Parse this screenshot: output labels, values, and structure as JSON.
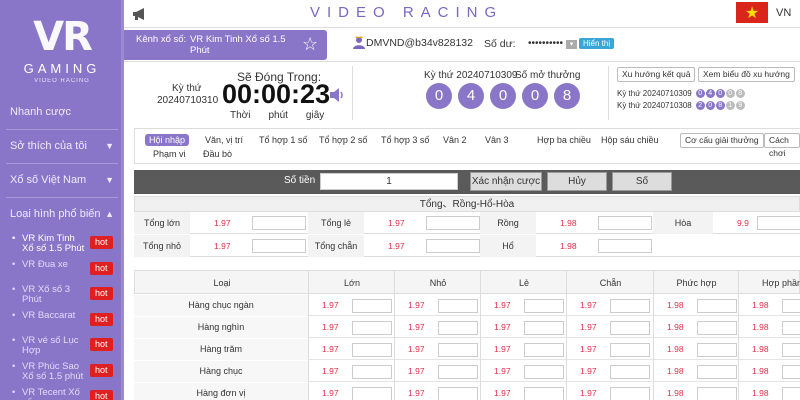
{
  "brand": {
    "logo_main": "VR",
    "logo_gaming": "GAMING",
    "logo_sub": "VIDEO RACING"
  },
  "sidebar": {
    "items": [
      {
        "label": "Nhanh cược",
        "caret": ""
      },
      {
        "label": "Sở thích của tôi",
        "caret": "▼"
      },
      {
        "label": "Xổ số Việt Nam",
        "caret": "▼"
      },
      {
        "label": "Loại hình phổ biến",
        "caret": "▲"
      }
    ],
    "games": [
      {
        "label": "VR Kim Tinh Xổ số 1.5 Phút",
        "badge": "hot"
      },
      {
        "label": "VR Đua xe",
        "badge": "hot"
      },
      {
        "label": "VR Xổ số 3 Phút",
        "badge": "hot"
      },
      {
        "label": "VR Baccarat",
        "badge": "hot"
      },
      {
        "label": "VR vé số Lục Hợp",
        "badge": "hot"
      },
      {
        "label": "VR Phúc Sao Xổ số 1.5 phút",
        "badge": "hot"
      },
      {
        "label": "VR Tecent Xổ số",
        "badge": "hot"
      }
    ]
  },
  "topbar": {
    "title": "VIDEO RACING",
    "lang": "VN",
    "flag_star": "★"
  },
  "channel": {
    "label": "Kênh xổ số:",
    "value": "VR Kim Tinh Xổ số 1.5 Phút",
    "user_id": "DMVND@b34v828132",
    "balance_label": "Số dư:",
    "balance_value": "••••••••••",
    "dropdown": "▾",
    "show_button": "Hiển thị"
  },
  "draw": {
    "kythu_label": "Kỳ thứ",
    "kythu_value": "20240710310",
    "countdown_title": "Sẽ Đóng Trong:",
    "countdown": "00:00:23",
    "units": {
      "hours": "Thời",
      "minutes": "phút",
      "seconds": "giây"
    },
    "last_draw_label": "Kỳ thứ 20240710309",
    "result_label": "Số mở thưởng",
    "result_balls": [
      "0",
      "4",
      "0",
      "0",
      "8"
    ],
    "trend_button": "Xu hướng kết quả",
    "chart_button": "Xem biểu đồ xu hướng",
    "history": [
      {
        "label": "Kỳ thứ 20240710309",
        "balls": [
          "0",
          "4",
          "0",
          "0",
          "8"
        ],
        "grey": [
          false,
          false,
          false,
          true,
          true
        ]
      },
      {
        "label": "Kỳ thứ 20240710308",
        "balls": [
          "2",
          "0",
          "8",
          "1",
          "9"
        ],
        "grey": [
          false,
          false,
          false,
          true,
          true
        ]
      }
    ]
  },
  "tabs": {
    "row1": [
      "Hội nhập",
      "Văn, vị trí",
      "Tổ hợp 1 số",
      "Tổ hợp 2 số",
      "Tổ hợp 3 số",
      "Vân 2",
      "Vân 3",
      "Hợp ba chiều",
      "Hộp sáu chiều"
    ],
    "row2": [
      "Phạm vi",
      "Đầu bò"
    ],
    "right_buttons": [
      "Cơ cấu giải thưởng",
      "Cách chơi"
    ]
  },
  "amount": {
    "label": "Số tiền",
    "value": "1",
    "confirm": "Xác nhận cược",
    "cancel": "Hủy",
    "number": "Số"
  },
  "section1": {
    "title": "Tổng、Rồng-Hổ-Hòa",
    "rows": [
      [
        {
          "name": "Tổng lớn",
          "odds": "1.97"
        },
        {
          "name": "Tổng lẻ",
          "odds": "1.97"
        },
        {
          "name": "Rồng",
          "odds": "1.98"
        },
        {
          "name": "Hòa",
          "odds": "9.9"
        }
      ],
      [
        {
          "name": "Tổng nhỏ",
          "odds": "1.97"
        },
        {
          "name": "Tổng chẵn",
          "odds": "1.97"
        },
        {
          "name": "Hổ",
          "odds": "1.98"
        }
      ]
    ]
  },
  "section2": {
    "headers": [
      "Loại",
      "Lớn",
      "Nhỏ",
      "Lẻ",
      "Chẵn",
      "Phức hợp",
      "Hợp phần"
    ],
    "rows": [
      {
        "name": "Hàng chục ngàn",
        "odds": [
          "1.97",
          "1.97",
          "1.97",
          "1.97",
          "1.98",
          "1.98"
        ]
      },
      {
        "name": "Hàng nghìn",
        "odds": [
          "1.97",
          "1.97",
          "1.97",
          "1.97",
          "1.98",
          "1.98"
        ]
      },
      {
        "name": "Hàng trăm",
        "odds": [
          "1.97",
          "1.97",
          "1.97",
          "1.97",
          "1.98",
          "1.98"
        ]
      },
      {
        "name": "Hàng chục",
        "odds": [
          "1.97",
          "1.97",
          "1.97",
          "1.97",
          "1.98",
          "1.98"
        ]
      },
      {
        "name": "Hàng đơn vị",
        "odds": [
          "1.97",
          "1.97",
          "1.97",
          "1.97",
          "1.98",
          "1.98"
        ]
      }
    ]
  },
  "colors": {
    "accent": "#8a76c8",
    "odds": "#e0304a",
    "hot": "#e02020",
    "show_button": "#3aa6d8"
  }
}
